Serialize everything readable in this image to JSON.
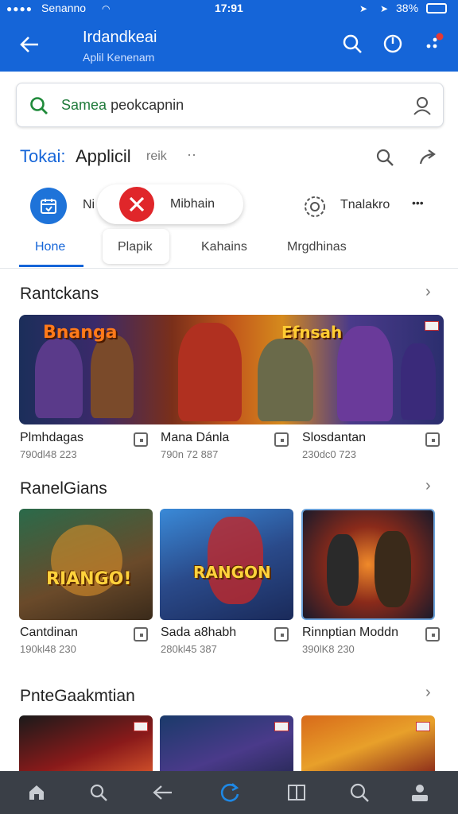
{
  "status_bar": {
    "carrier": "Senanno",
    "time": "17:91",
    "battery": "38%"
  },
  "app_bar": {
    "title": "Irdandkeai",
    "subtitle": "Aplil Kenenam",
    "icons": [
      "back-arrow-icon",
      "search-icon",
      "power-icon",
      "notification-icon"
    ]
  },
  "search": {
    "prefix": "Samea",
    "value": "peokcapnin",
    "icons": [
      "search-icon",
      "voice-profile-icon"
    ]
  },
  "title_row": {
    "blue": "Tokai:",
    "main": "Applicil",
    "small": "reik",
    "dots": "··"
  },
  "chips": {
    "first_label": "Ni",
    "pill_label": "Mibhain",
    "settings_label": "Tnalakro",
    "more": "•••"
  },
  "tabs": [
    {
      "label": "Hone",
      "active": true
    },
    {
      "label": "Plapik",
      "active": false
    },
    {
      "label": "Kahains",
      "active": false
    },
    {
      "label": "Mrgdhinas",
      "active": false
    }
  ],
  "sections": [
    {
      "title": "Rantckans",
      "games": [
        {
          "title": "Plmhdagas",
          "meta": "790dl48 223"
        },
        {
          "title": "Mana Dánla",
          "meta": "790n 72 887"
        },
        {
          "title": "Slosdantan",
          "meta": "230dc0 723"
        }
      ]
    },
    {
      "title": "RanelGians",
      "games": [
        {
          "title": "Cantdinan",
          "meta": "190kl48 230",
          "art_text": "RIANGO!"
        },
        {
          "title": "Sada a8habh",
          "meta": "280kl45 387",
          "art_text": "RANGON"
        },
        {
          "title": "Rinnptian Moddn",
          "meta": "390lK8 230"
        }
      ]
    },
    {
      "title": "PnteGaakmtian",
      "games": []
    }
  ],
  "banner": {
    "left_text": "Bnanga",
    "right_text": "Efnsah"
  },
  "colors": {
    "primary": "#1565d8",
    "accent_red": "#e0262a",
    "nav_bg": "#3a3f47"
  },
  "bottom_nav": [
    "home-icon",
    "search-icon",
    "back-icon",
    "refresh-icon",
    "book-icon",
    "search-icon",
    "profile-icon"
  ]
}
